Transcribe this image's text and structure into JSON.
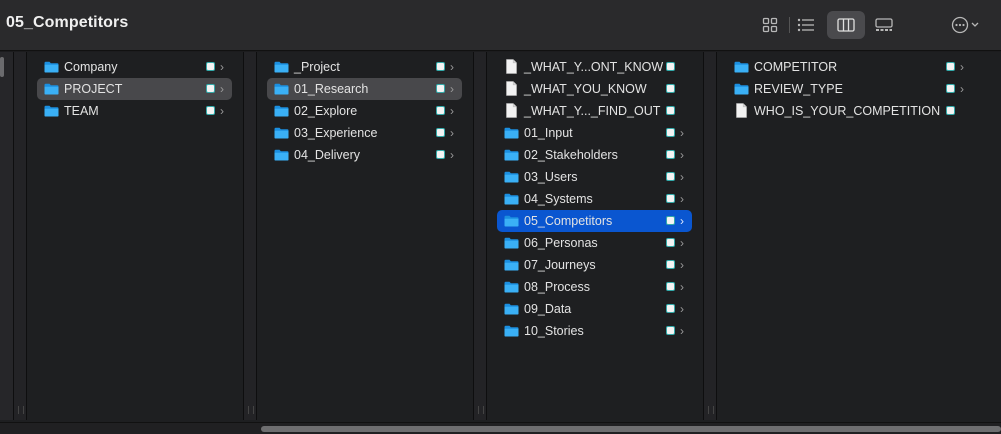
{
  "window": {
    "title": "05_Competitors"
  },
  "toolbar": {
    "icons": [
      "grid-view-icon",
      "list-view-icon",
      "column-view-icon",
      "gallery-view-icon",
      "more-actions-icon"
    ]
  },
  "columns": [
    {
      "items": [
        {
          "label": "Company",
          "kind": "folder",
          "selected": ""
        },
        {
          "label": "PROJECT",
          "kind": "folder",
          "selected": "grey"
        },
        {
          "label": "TEAM",
          "kind": "folder",
          "selected": ""
        }
      ]
    },
    {
      "items": [
        {
          "label": "_Project",
          "kind": "folder",
          "selected": ""
        },
        {
          "label": "01_Research",
          "kind": "folder",
          "selected": "grey"
        },
        {
          "label": "02_Explore",
          "kind": "folder",
          "selected": ""
        },
        {
          "label": "03_Experience",
          "kind": "folder",
          "selected": ""
        },
        {
          "label": "04_Delivery",
          "kind": "folder",
          "selected": ""
        }
      ]
    },
    {
      "items": [
        {
          "label": "_WHAT_Y...ONT_KNOW",
          "kind": "file",
          "selected": ""
        },
        {
          "label": "_WHAT_YOU_KNOW",
          "kind": "file",
          "selected": ""
        },
        {
          "label": "_WHAT_Y..._FIND_OUT",
          "kind": "file",
          "selected": ""
        },
        {
          "label": "01_Input",
          "kind": "folder",
          "selected": ""
        },
        {
          "label": "02_Stakeholders",
          "kind": "folder",
          "selected": ""
        },
        {
          "label": "03_Users",
          "kind": "folder",
          "selected": ""
        },
        {
          "label": "04_Systems",
          "kind": "folder",
          "selected": ""
        },
        {
          "label": "05_Competitors",
          "kind": "folder",
          "selected": "blue"
        },
        {
          "label": "06_Personas",
          "kind": "folder",
          "selected": ""
        },
        {
          "label": "07_Journeys",
          "kind": "folder",
          "selected": ""
        },
        {
          "label": "08_Process",
          "kind": "folder",
          "selected": ""
        },
        {
          "label": "09_Data",
          "kind": "folder",
          "selected": ""
        },
        {
          "label": "10_Stories",
          "kind": "folder",
          "selected": ""
        }
      ]
    },
    {
      "items": [
        {
          "label": "COMPETITOR",
          "kind": "folder",
          "selected": ""
        },
        {
          "label": "REVIEW_TYPE",
          "kind": "folder",
          "selected": ""
        },
        {
          "label": "WHO_IS_YOUR_COMPETITION",
          "kind": "file",
          "selected": ""
        }
      ]
    }
  ],
  "colors": {
    "selection_blue": "#0a56d0",
    "selection_grey": "#48484b",
    "folder_blue": "#1e9ef0"
  }
}
